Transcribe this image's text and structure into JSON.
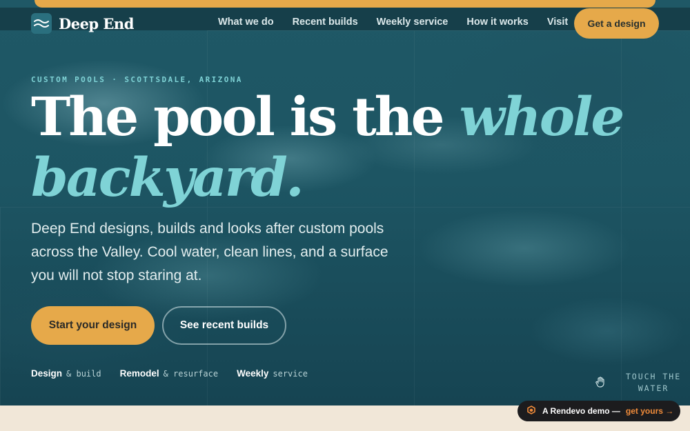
{
  "brand": {
    "name": "Deep End",
    "logo_icon": "wave-logo-icon"
  },
  "nav": {
    "links": [
      "What we do",
      "Recent builds",
      "Weekly service",
      "How it works",
      "Visit"
    ],
    "cta": "Get a design"
  },
  "hero": {
    "eyebrow": "CUSTOM POOLS · SCOTTSDALE, ARIZONA",
    "headline_plain": "The pool is the",
    "headline_accent_1": "whole",
    "headline_accent_2": "backyard.",
    "lede": "Deep End designs, builds and looks after custom pools across the Valley. Cool water, clean lines, and a surface you will not stop staring at.",
    "primary_cta": "Start your design",
    "secondary_cta": "See recent builds",
    "services": [
      {
        "strong": "Design",
        "rest": "& build"
      },
      {
        "strong": "Remodel",
        "rest": "& resurface"
      },
      {
        "strong": "Weekly",
        "rest": "service"
      }
    ],
    "touch_label_1": "TOUCH THE",
    "touch_label_2": "WATER",
    "touch_icon": "hand-pointer-icon"
  },
  "badge": {
    "text": "A Rendevo demo —",
    "link": "get yours →",
    "icon": "rendevo-logo-icon"
  },
  "colors": {
    "accent_gold": "#e6a94a",
    "accent_aqua": "#7fd3d6",
    "nav_bg": "#163f4a",
    "water": "#1d5563",
    "cream": "#f1e7d8"
  }
}
